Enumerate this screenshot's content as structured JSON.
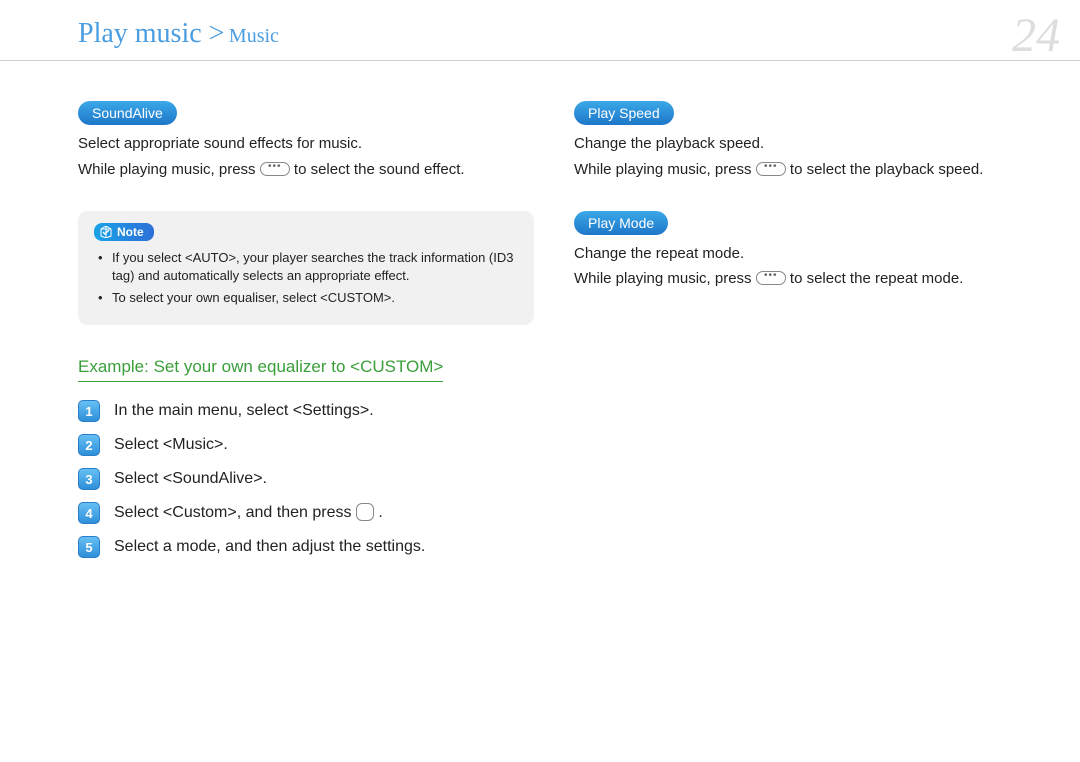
{
  "header": {
    "title_main": "Play music >",
    "title_sub": "Music",
    "page_number": "24"
  },
  "left": {
    "soundalive": {
      "label": "SoundAlive",
      "line1": "Select appropriate sound effects for music.",
      "line2_pre": "While playing music, press ",
      "line2_post": " to select the sound effect."
    },
    "note": {
      "label": "Note",
      "items": [
        "If you select <AUTO>, your player searches the track information (ID3 tag) and automatically selects an appropriate effect.",
        "To select your own equaliser, select <CUSTOM>."
      ]
    },
    "example": {
      "heading": "Example: Set your own equalizer to <CUSTOM>",
      "steps": [
        "In the main menu, select <Settings>.",
        "Select <Music>.",
        "Select <SoundAlive>.",
        "Select <Custom>, and then press ",
        "Select a mode, and then adjust the settings."
      ],
      "step4_post": "."
    }
  },
  "right": {
    "playspeed": {
      "label": "Play Speed",
      "line1": "Change the playback speed.",
      "line2_pre": "While playing music, press ",
      "line2_post": " to select the playback speed."
    },
    "playmode": {
      "label": "Play Mode",
      "line1": "Change the repeat mode.",
      "line2_pre": "While playing music, press ",
      "line2_post": " to select the repeat mode."
    }
  }
}
